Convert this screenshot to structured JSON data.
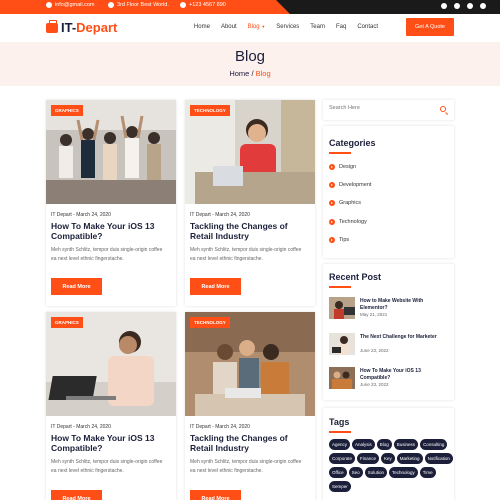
{
  "topbar": {
    "email": "info@gmail.com",
    "address": "3rd Floor Best World.",
    "phone": "+123 4567 890",
    "social_icons": [
      "facebook-icon",
      "twitter-icon",
      "instagram-icon",
      "pinterest-icon"
    ]
  },
  "header": {
    "logo_part1": "IT-",
    "logo_part2": "Depart",
    "nav": [
      "Home",
      "About",
      "Blog",
      "Services",
      "Team",
      "Faq",
      "Contact"
    ],
    "active_nav": "Blog",
    "cta": "Get A Quote"
  },
  "hero": {
    "title": "Blog",
    "crumb_home": "Home",
    "crumb_sep": " / ",
    "crumb_current": "Blog"
  },
  "posts": [
    {
      "tag": "GRAPHICS",
      "meta": "IT Depart - March 24, 2020",
      "title": "How To Make Your iOS 13 Compatible?",
      "desc": "Meh synth Schlitz, tempor duis single-origin coffee ea next level ethnic fingerstache.",
      "button": "Read More"
    },
    {
      "tag": "TECHNOLOGY",
      "meta": "IT Depart - March 24, 2020",
      "title": "Tackling the Changes of Retail Industry",
      "desc": "Meh synth Schlitz, tempor duis single-origin coffee ea next level ethnic fingerstache.",
      "button": "Read More"
    },
    {
      "tag": "GRAPHICS",
      "meta": "IT Depart - March 24, 2020",
      "title": "How To Make Your iOS 13 Compatible?",
      "desc": "Meh synth Schlitz, tempor duis single-origin coffee ea next level ethnic fingerstache.",
      "button": "Read More"
    },
    {
      "tag": "TECHNOLOGY",
      "meta": "IT Depart - March 24, 2020",
      "title": "Tackling the Changes of Retail Industry",
      "desc": "Meh synth Schlitz, tempor duis single-origin coffee ea next level ethnic fingerstache.",
      "button": "Read More"
    }
  ],
  "sidebar": {
    "search_placeholder": "Search Here",
    "categories_title": "Categories",
    "categories": [
      "Design",
      "Development",
      "Graphics",
      "Technology",
      "Tips"
    ],
    "recent_title": "Recent Post",
    "recent": [
      {
        "title": "How to Make Website With Elementor?",
        "date": "May 21, 2021"
      },
      {
        "title": "The Next Challenge for Marketer",
        "date": "June 23, 2022"
      },
      {
        "title": "How To Make Your iOS 13 Compatible?",
        "date": "June 23, 2022"
      }
    ],
    "tags_title": "Tags",
    "tags": [
      "Agency",
      "Analysis",
      "Blog",
      "Business",
      "Consulting",
      "Corporate",
      "Finance",
      "Key",
      "Marketing",
      "Notification",
      "Office",
      "Seo",
      "Solution",
      "Technology",
      "Time",
      "Semper"
    ]
  },
  "colors": {
    "accent": "#ff4f17",
    "dark": "#1b1f3a",
    "hero_bg": "#fdf1ee"
  }
}
